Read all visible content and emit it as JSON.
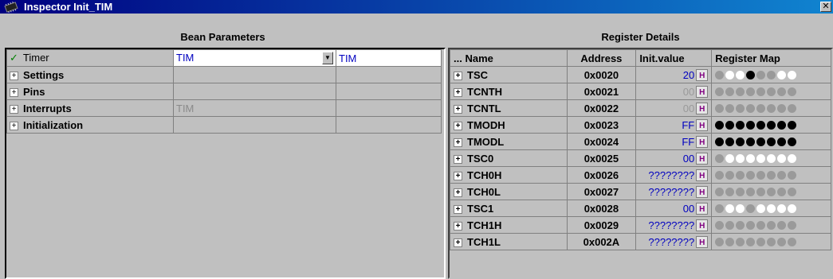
{
  "window": {
    "title": "Inspector Init_TIM",
    "close_label": "✕"
  },
  "bean_parameters": {
    "header": "Bean Parameters",
    "rows": [
      {
        "check": "✓",
        "name": "Timer",
        "value": "TIM",
        "extra": "TIM"
      },
      {
        "name": "Settings",
        "value": "",
        "extra": ""
      },
      {
        "name": "Pins",
        "value": "",
        "extra": ""
      },
      {
        "name": "Interrupts",
        "value": "TIM",
        "extra": ""
      },
      {
        "name": "Initialization",
        "value": "",
        "extra": ""
      }
    ],
    "expander_symbol": "+",
    "dropdown_symbol": "▼"
  },
  "register_details": {
    "header": "Register Details",
    "columns": [
      "...  Name",
      "Address",
      "Init.value",
      "Register Map"
    ],
    "badge_label": "H",
    "rows": [
      {
        "name": "TSC",
        "address": "0x0020",
        "init": "20",
        "init_color": "#0000c0",
        "map": [
          "g",
          "w",
          "w",
          "b",
          "g",
          "g",
          "w",
          "w"
        ]
      },
      {
        "name": "TCNTH",
        "address": "0x0021",
        "init": "00",
        "init_color": "#9a9a9a",
        "map": [
          "g",
          "g",
          "g",
          "g",
          "g",
          "g",
          "g",
          "g"
        ]
      },
      {
        "name": "TCNTL",
        "address": "0x0022",
        "init": "00",
        "init_color": "#9a9a9a",
        "map": [
          "g",
          "g",
          "g",
          "g",
          "g",
          "g",
          "g",
          "g"
        ]
      },
      {
        "name": "TMODH",
        "address": "0x0023",
        "init": "FF",
        "init_color": "#0000c0",
        "map": [
          "b",
          "b",
          "b",
          "b",
          "b",
          "b",
          "b",
          "b"
        ]
      },
      {
        "name": "TMODL",
        "address": "0x0024",
        "init": "FF",
        "init_color": "#0000c0",
        "map": [
          "b",
          "b",
          "b",
          "b",
          "b",
          "b",
          "b",
          "b"
        ]
      },
      {
        "name": "TSC0",
        "address": "0x0025",
        "init": "00",
        "init_color": "#0000c0",
        "map": [
          "g",
          "w",
          "w",
          "w",
          "w",
          "w",
          "w",
          "w"
        ]
      },
      {
        "name": "TCH0H",
        "address": "0x0026",
        "init": "????????",
        "init_color": "#0000c0",
        "map": [
          "g",
          "g",
          "g",
          "g",
          "g",
          "g",
          "g",
          "g"
        ]
      },
      {
        "name": "TCH0L",
        "address": "0x0027",
        "init": "????????",
        "init_color": "#0000c0",
        "map": [
          "g",
          "g",
          "g",
          "g",
          "g",
          "g",
          "g",
          "g"
        ]
      },
      {
        "name": "TSC1",
        "address": "0x0028",
        "init": "00",
        "init_color": "#0000c0",
        "map": [
          "g",
          "w",
          "w",
          "g",
          "w",
          "w",
          "w",
          "w"
        ]
      },
      {
        "name": "TCH1H",
        "address": "0x0029",
        "init": "????????",
        "init_color": "#0000c0",
        "map": [
          "g",
          "g",
          "g",
          "g",
          "g",
          "g",
          "g",
          "g"
        ]
      },
      {
        "name": "TCH1L",
        "address": "0x002A",
        "init": "????????",
        "init_color": "#0000c0",
        "map": [
          "g",
          "g",
          "g",
          "g",
          "g",
          "g",
          "g",
          "g"
        ]
      }
    ]
  },
  "colors": {
    "titlebar_start": "#000080",
    "titlebar_end": "#1084d0",
    "badge_text": "#800080"
  }
}
